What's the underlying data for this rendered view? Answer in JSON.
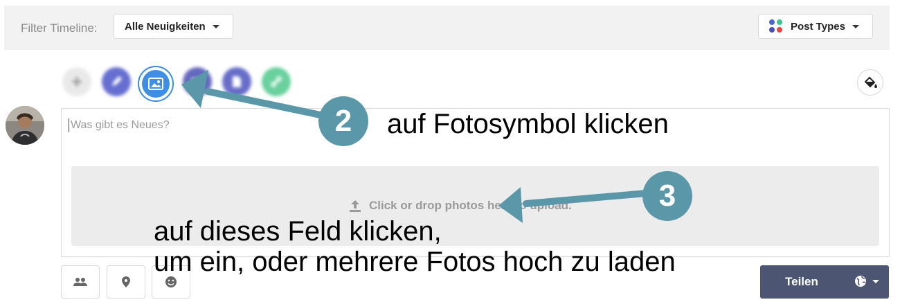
{
  "filter_bar": {
    "label": "Filter Timeline:",
    "timeline_dropdown": "Alle Neuigkeiten",
    "post_types_dropdown": "Post Types"
  },
  "post_type_icons": [
    "plus-icon",
    "pencil-icon",
    "photo-icon",
    "video-icon",
    "document-icon",
    "link-icon"
  ],
  "composer": {
    "placeholder": "Was gibt es Neues?",
    "dropzone_text": "Click or drop photos here to upload."
  },
  "actions": {
    "share_label": "Teilen"
  },
  "annotations": {
    "step2_number": "2",
    "step2_text": "auf Fotosymbol klicken",
    "step3_number": "3",
    "step3_line1": "auf dieses Feld klicken,",
    "step3_line2": "um ein, oder mehrere Fotos hoch zu laden"
  },
  "colors": {
    "annotation": "#5a98a9",
    "share_button": "#4c5673",
    "photo_icon": "#3e8ee6",
    "dots": [
      "#4d63d6",
      "#3cc48a",
      "#4a4fb8",
      "#e84545"
    ]
  }
}
